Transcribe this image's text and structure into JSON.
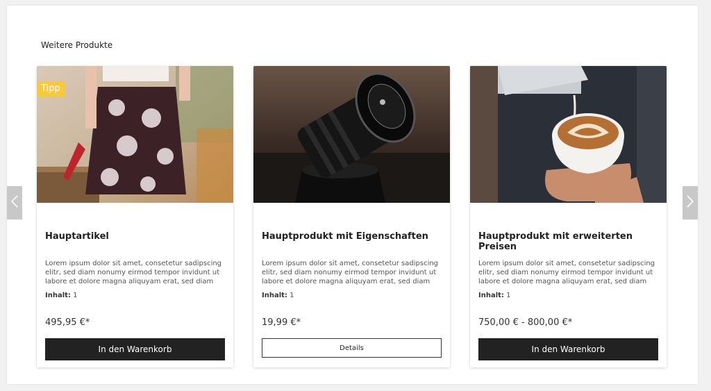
{
  "section": {
    "title": "Weitere Produkte"
  },
  "colors": {
    "badge": "#f8c93a",
    "button": "#222222"
  },
  "products": [
    {
      "badge": "Tipp",
      "name": "Hauptartikel",
      "description": "Lorem ipsum dolor sit amet, consetetur sadipscing elitr, sed diam nonumy eirmod tempor invidunt ut labore et dolore magna aliquyam erat, sed diam",
      "content_label": "Inhalt:",
      "content_value": "1",
      "price": "495,95 €*",
      "button": "In den Warenkorb"
    },
    {
      "name": "Hauptprodukt mit Eigenschaften",
      "description": "Lorem ipsum dolor sit amet, consetetur sadipscing elitr, sed diam nonumy eirmod tempor invidunt ut labore et dolore magna aliquyam erat, sed diam",
      "content_label": "Inhalt:",
      "content_value": "1",
      "price": "19,99 €*",
      "button": "Details"
    },
    {
      "name": "Hauptprodukt mit erweiterten Preisen",
      "description": "Lorem ipsum dolor sit amet, consetetur sadipscing elitr, sed diam nonumy eirmod tempor invidunt ut labore et dolore magna aliquyam erat, sed diam",
      "content_label": "Inhalt:",
      "content_value": "1",
      "price": "750,00 € - 800,00 €*",
      "button": "In den Warenkorb"
    }
  ],
  "nav": {
    "prev_icon": "chevron-left-icon",
    "next_icon": "chevron-right-icon"
  }
}
